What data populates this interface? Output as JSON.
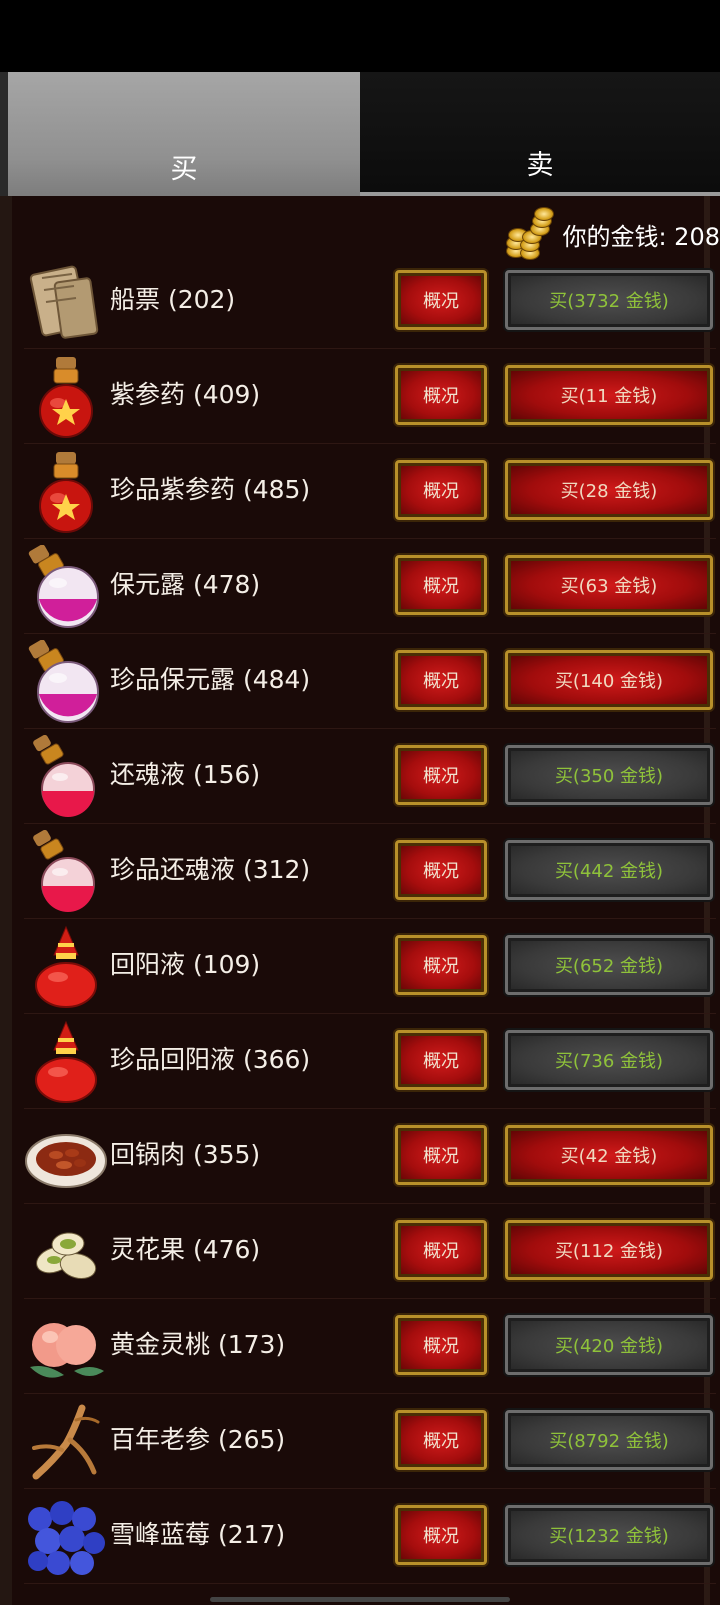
{
  "tabs": {
    "buy": "买",
    "sell": "卖"
  },
  "money": {
    "label": "你的金钱: 208"
  },
  "info_label": "概况",
  "items": [
    {
      "name": "船票 (202)",
      "buy": "买(3732 金钱)",
      "affordable": false,
      "icon": "scroll-icon"
    },
    {
      "name": "紫参药 (409)",
      "buy": "买(11 金钱)",
      "affordable": true,
      "icon": "red-potion-icon"
    },
    {
      "name": "珍品紫参药 (485)",
      "buy": "买(28 金钱)",
      "affordable": true,
      "icon": "red-potion-icon"
    },
    {
      "name": "保元露 (478)",
      "buy": "买(63 金钱)",
      "affordable": true,
      "icon": "pink-potion-icon"
    },
    {
      "name": "珍品保元露 (484)",
      "buy": "买(140 金钱)",
      "affordable": true,
      "icon": "pink-potion-icon"
    },
    {
      "name": "还魂液 (156)",
      "buy": "买(350 金钱)",
      "affordable": false,
      "icon": "rose-potion-icon"
    },
    {
      "name": "珍品还魂液 (312)",
      "buy": "买(442 金钱)",
      "affordable": false,
      "icon": "rose-potion-icon"
    },
    {
      "name": "回阳液 (109)",
      "buy": "买(652 金钱)",
      "affordable": false,
      "icon": "red-flask-icon"
    },
    {
      "name": "珍品回阳液 (366)",
      "buy": "买(736 金钱)",
      "affordable": false,
      "icon": "red-flask-icon"
    },
    {
      "name": "回锅肉 (355)",
      "buy": "买(42 金钱)",
      "affordable": true,
      "icon": "meat-dish-icon"
    },
    {
      "name": "灵花果 (476)",
      "buy": "买(112 金钱)",
      "affordable": true,
      "icon": "pistachio-icon"
    },
    {
      "name": "黄金灵桃 (173)",
      "buy": "买(420 金钱)",
      "affordable": false,
      "icon": "peach-icon"
    },
    {
      "name": "百年老参 (265)",
      "buy": "买(8792 金钱)",
      "affordable": false,
      "icon": "ginseng-icon"
    },
    {
      "name": "雪峰蓝莓 (217)",
      "buy": "买(1232 金钱)",
      "affordable": false,
      "icon": "blueberry-icon"
    }
  ]
}
